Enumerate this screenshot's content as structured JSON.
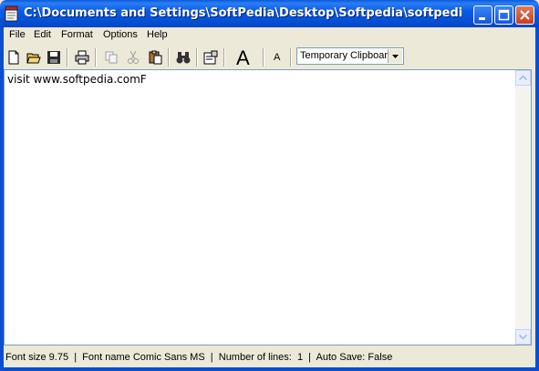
{
  "window": {
    "title": "C:\\Documents and Settings\\SoftPedia\\Desktop\\Softpedia\\softpedia.txt[*] Nik..."
  },
  "menu": {
    "items": [
      {
        "label": "File"
      },
      {
        "label": "Edit"
      },
      {
        "label": "Format"
      },
      {
        "label": "Options"
      },
      {
        "label": "Help"
      }
    ]
  },
  "toolbar": {
    "font_large_label": "A",
    "font_small_label": "A",
    "clipboard_select": "Temporary Clipboard"
  },
  "editor": {
    "content": "visit www.softpedia.comF"
  },
  "status": {
    "text": "Font size 9.75  |  Font name Comic Sans MS  |  Number of lines:  1  |  Auto Save: False"
  },
  "colors": {
    "titlebar": "#0a5ce5",
    "chrome": "#ece9d8",
    "close_button": "#c2401e"
  }
}
